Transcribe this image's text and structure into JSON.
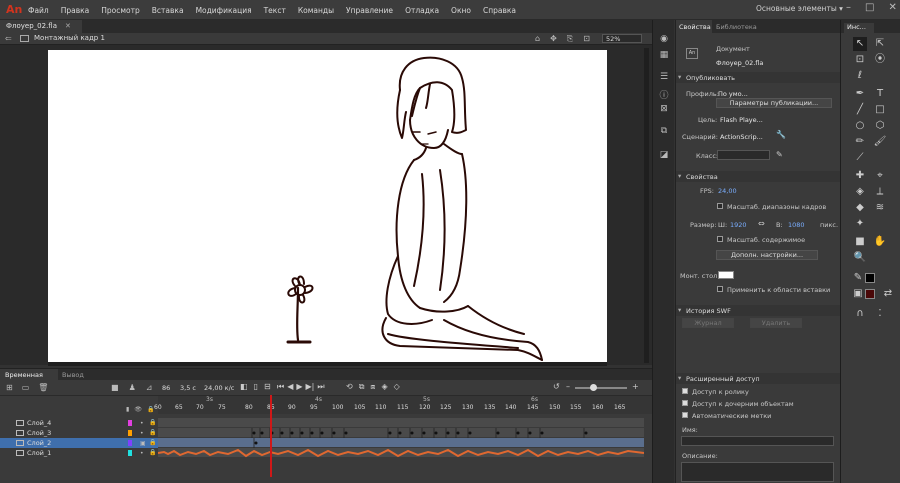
{
  "app": {
    "logo": "An",
    "menu": [
      "Файл",
      "Правка",
      "Просмотр",
      "Вставка",
      "Модификация",
      "Текст",
      "Команды",
      "Управление",
      "Отладка",
      "Окно",
      "Справка"
    ],
    "workspace": "Основные элементы ▾"
  },
  "document": {
    "tab": "Флоуер_02.fla",
    "scene": "Монтажный кадр 1",
    "zoom": "52%"
  },
  "timeline": {
    "tabs": [
      "Временная шкала",
      "Вывод"
    ],
    "current_frame": "86",
    "time": "3,5 с",
    "fps": "24,00 к/с",
    "seconds": [
      "3s",
      "4s",
      "5s",
      "6s"
    ],
    "frame_numbers": [
      "60",
      "65",
      "70",
      "75",
      "80",
      "85",
      "90",
      "95",
      "100",
      "105",
      "110",
      "115",
      "120",
      "125",
      "130",
      "135",
      "140",
      "145",
      "150",
      "155",
      "160",
      "165"
    ],
    "layers": [
      {
        "name": "Слой_4",
        "color": "#e040e0"
      },
      {
        "name": "Слой_3",
        "color": "#ffa000"
      },
      {
        "name": "Слой_2",
        "color": "#8040ff"
      },
      {
        "name": "Слой_1",
        "color": "#20e0e0"
      }
    ]
  },
  "properties": {
    "tabs": [
      "Свойства",
      "Библиотека"
    ],
    "doc_type": "Документ",
    "doc_name": "Флоуер_02.fla",
    "publish": {
      "title": "Опубликовать",
      "profile_label": "Профиль:",
      "profile_value": "По умо...",
      "publish_settings_btn": "Параметры публикации...",
      "target_label": "Цель:",
      "target_value": "Flash Playe...",
      "script_label": "Сценарий:",
      "script_value": "ActionScrip...",
      "class_label": "Класс:"
    },
    "props": {
      "title": "Свойства",
      "fps_label": "FPS:",
      "fps_value": "24,00",
      "scale_spans": "Масштаб. диапазоны кадров",
      "size_label": "Размер:",
      "w_label": "Ш:",
      "w_value": "1920",
      "h_label": "В:",
      "h_value": "1080",
      "units": "пикс.",
      "scale_content": "Масштаб. содержимое",
      "more_settings_btn": "Дополн. настройки...",
      "stage_label": "Монт. стол:",
      "stage_color": "#ffffff",
      "apply_paste": "Применить к области вставки"
    },
    "swf_history": {
      "title": "История SWF",
      "log_btn": "Журнал",
      "clear_btn": "Удалить"
    },
    "accessibility": {
      "title": "Расширенный доступ",
      "movie_access": "Доступ к ролику",
      "child_access": "Доступ к дочерним объектам",
      "auto_labels": "Автоматические метки",
      "name_label": "Имя:",
      "desc_label": "Описание:"
    }
  },
  "tools_panel": {
    "title": "Инс..."
  }
}
